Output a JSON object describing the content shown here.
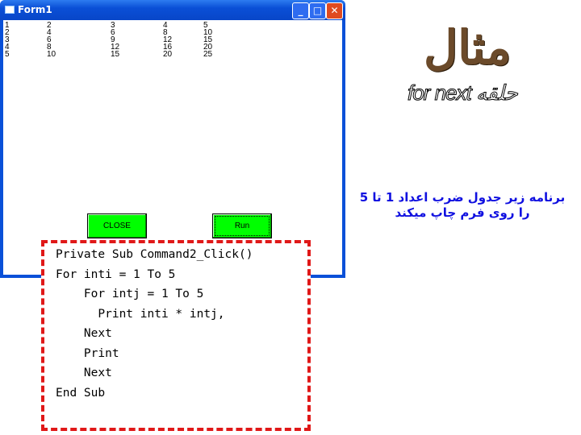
{
  "window": {
    "title": "Form1",
    "minimize": "_",
    "maximize": "□",
    "close": "✕"
  },
  "table": [
    [
      "1",
      "2",
      "3",
      "4",
      "5"
    ],
    [
      "2",
      "4",
      "6",
      "8",
      "10"
    ],
    [
      "3",
      "6",
      "9",
      "12",
      "15"
    ],
    [
      "4",
      "8",
      "12",
      "16",
      "20"
    ],
    [
      "5",
      "10",
      "15",
      "20",
      "25"
    ]
  ],
  "buttons": {
    "close": "CLOSE",
    "run": "Run"
  },
  "code": [
    "Private Sub Command2_Click()",
    "For inti = 1 To 5",
    "    For intj = 1 To 5",
    "      Print inti * intj,",
    "    Next",
    "    Print",
    "    Next",
    "End Sub"
  ],
  "heading": "مثال",
  "subheading": "for next حلقه",
  "description": [
    "برنامه زیر جدول ضرب اعداد 1 تا 5",
    "را روی فرم چاپ میکند"
  ],
  "colors": {
    "button": "#00ff00",
    "border": "#e01818",
    "description": "#1010e0"
  }
}
